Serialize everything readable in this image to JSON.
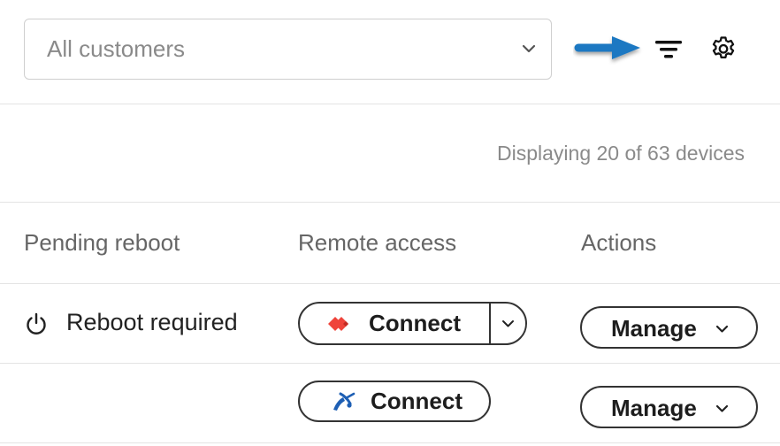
{
  "filter": {
    "customer_select": "All customers"
  },
  "summary": {
    "display_count": "Displaying 20 of 63 devices"
  },
  "table": {
    "columns": [
      "Pending reboot",
      "Remote access",
      "Actions"
    ],
    "rows": [
      {
        "pending_reboot": "Reboot required",
        "remote_access_label": "Connect",
        "remote_access_icon": "anydesk-icon",
        "actions_label": "Manage"
      },
      {
        "pending_reboot": "",
        "remote_access_label": "Connect",
        "remote_access_icon": "splashtop-icon",
        "actions_label": "Manage"
      }
    ]
  },
  "colors": {
    "arrow": "#1a78c2",
    "anydesk": "#ef443b",
    "splashtop": "#1e5fb4",
    "border": "#333333",
    "muted_text": "#8a8a8a"
  }
}
